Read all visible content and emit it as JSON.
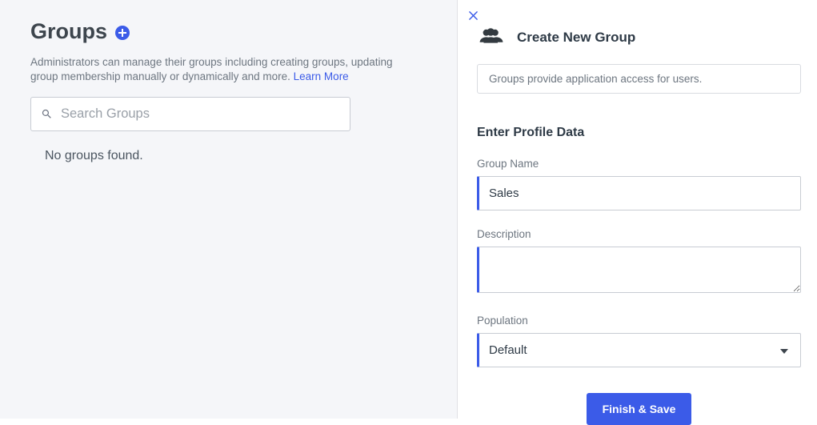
{
  "left": {
    "title": "Groups",
    "subtext": "Administrators can manage their groups including creating groups, updating group membership manually or dynamically and more. ",
    "learn_more": "Learn More",
    "search_placeholder": "Search Groups",
    "empty_state": "No groups found."
  },
  "panel": {
    "title": "Create New Group",
    "info": "Groups provide application access for users.",
    "section_title": "Enter Profile Data",
    "fields": {
      "name_label": "Group Name",
      "name_value": "Sales",
      "desc_label": "Description",
      "desc_value": "",
      "pop_label": "Population",
      "pop_value": "Default"
    },
    "submit_label": "Finish & Save"
  }
}
